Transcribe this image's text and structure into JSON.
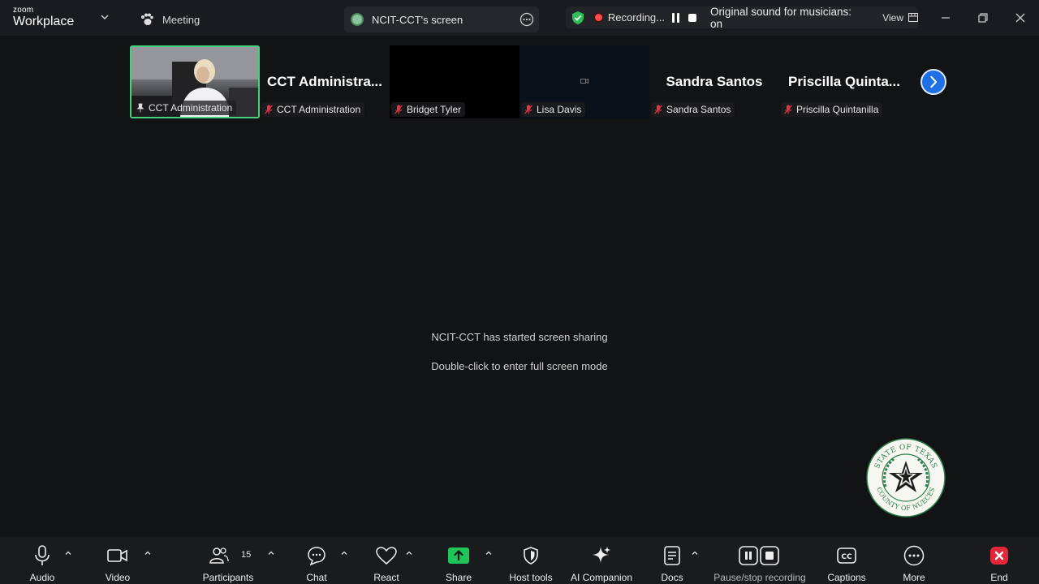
{
  "app": {
    "brand_top": "zoom",
    "brand_bottom": "Workplace"
  },
  "tabs": {
    "meeting": "Meeting",
    "screen": "NCIT-CCT's screen"
  },
  "recording_bar": {
    "status": "Recording...",
    "sound": "Original sound for musicians: on",
    "view": "View"
  },
  "participants_strip": [
    {
      "tag": "CCT Administration",
      "big_name": "",
      "video": true,
      "muted": false,
      "pinned": true
    },
    {
      "tag": "CCT Administration",
      "big_name": "CCT  Administra...",
      "video": false,
      "muted": true
    },
    {
      "tag": "Bridget Tyler",
      "big_name": "",
      "video": false,
      "muted": true
    },
    {
      "tag": "Lisa Davis",
      "big_name": "",
      "video": false,
      "muted": true
    },
    {
      "tag": "Sandra Santos",
      "big_name": "Sandra Santos",
      "video": false,
      "muted": true
    },
    {
      "tag": "Priscilla Quintanilla",
      "big_name": "Priscilla  Quinta...",
      "video": false,
      "muted": true
    }
  ],
  "center": {
    "line1": "NCIT-CCT has started screen sharing",
    "line2": "Double-click to enter full screen mode"
  },
  "seal": {
    "top_text": "STATE OF TEXAS",
    "bottom_text": "COUNTY OF NUECES"
  },
  "toolbar": {
    "audio": "Audio",
    "video": "Video",
    "participants": "Participants",
    "participants_count": "15",
    "chat": "Chat",
    "react": "React",
    "share": "Share",
    "host_tools": "Host tools",
    "ai_companion": "AI Companion",
    "docs": "Docs",
    "pause_stop": "Pause/stop recording",
    "captions": "Captions",
    "more": "More",
    "end": "End"
  },
  "colors": {
    "accent_green": "#46d27a",
    "share_green": "#1fc45a",
    "recording_red": "#ff4a4a",
    "end_red": "#e0283a",
    "next_blue": "#1f6fe5"
  }
}
